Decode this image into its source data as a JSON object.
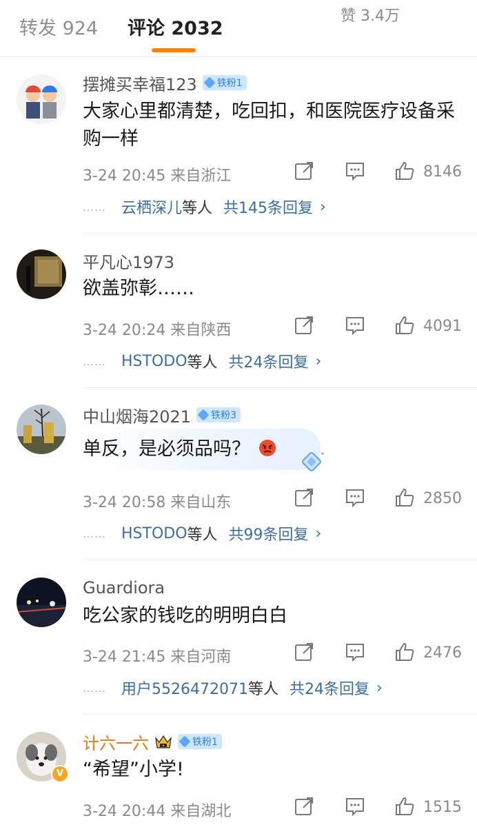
{
  "tabs": {
    "repost": "转发 924",
    "comments": "评论 2032",
    "likes": "赞 3.4万"
  },
  "colors": {
    "accent": "#ff8200",
    "link": "#3a6ea5",
    "badge_bg": "#cfe6ff"
  },
  "comments": [
    {
      "user": "摆摊买幸福123",
      "badge": "铁粉1",
      "text": "大家心里都清楚，吃回扣，和医院医疗设备采购一样",
      "time": "3-24 20:45 来自浙江",
      "likes": "8146",
      "sub_dots": "……",
      "sub_user": "云栖深儿",
      "sub_etc": "等人",
      "sub_count": "共145条回复",
      "chevron": "›"
    },
    {
      "user": "平凡心1973",
      "text": "欲盖弥彰……",
      "time": "3-24 20:24 来自陕西",
      "likes": "4091",
      "sub_dots": "……",
      "sub_user": "HSTODO",
      "sub_etc": "等人",
      "sub_count": "共24条回复",
      "chevron": "›"
    },
    {
      "user": "中山烟海2021",
      "badge": "铁粉3",
      "text": "单反，是必须品吗？",
      "emoji": "angry-face-icon",
      "time": "3-24 20:58 来自山东",
      "likes": "2850",
      "sub_dots": "……",
      "sub_user": "HSTODO",
      "sub_etc": "等人",
      "sub_count": "共99条回复",
      "chevron": "›"
    },
    {
      "user": "Guardiora",
      "text": "吃公家的钱吃的明明白白",
      "time": "3-24 21:45 来自河南",
      "likes": "2476",
      "sub_dots": "……",
      "sub_user": "用户5526472071",
      "sub_etc": "等人",
      "sub_count": "共24条回复",
      "chevron": "›"
    },
    {
      "user": "计六一六",
      "badge": "铁粉1",
      "verified": "V",
      "text": "“希望”小学!",
      "time": "3-24 20:44 来自湖北",
      "likes": "1515"
    }
  ]
}
